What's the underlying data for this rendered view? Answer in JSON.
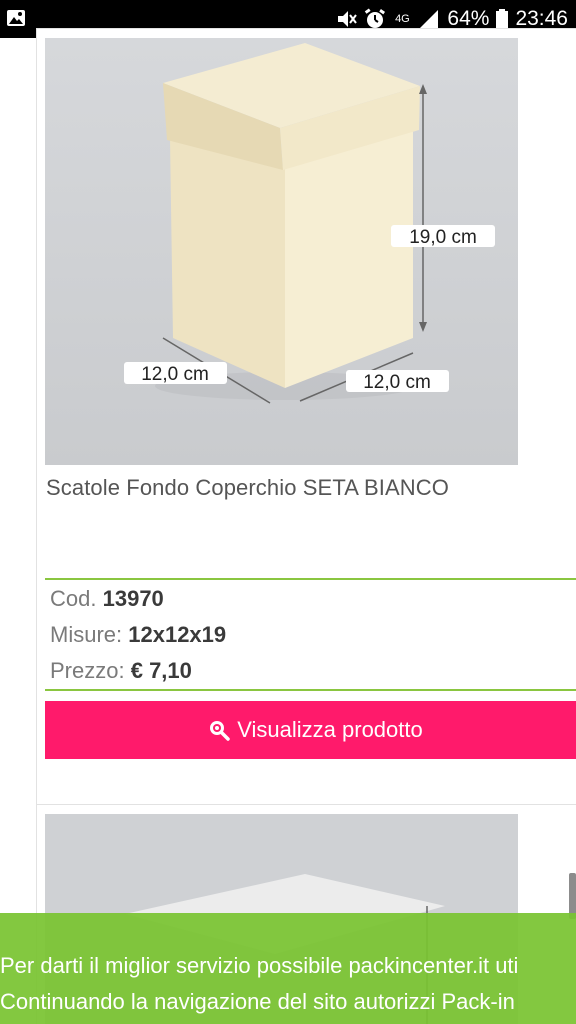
{
  "status_bar": {
    "network": "4G",
    "battery": "64%",
    "time": "23:46"
  },
  "product": {
    "image_labels": {
      "height": "19,0 cm",
      "depth": "12,0 cm",
      "width": "12,0 cm"
    },
    "title": "Scatole Fondo Coperchio SETA BIANCO",
    "code_label": "Cod.",
    "code_value": "13970",
    "size_label": "Misure:",
    "size_value": "12x12x19",
    "price_label": "Prezzo:",
    "price_value": "€ 7,10",
    "view_button": "Visualizza prodotto"
  },
  "cookie_banner": {
    "line1": "Per darti il miglior servizio possibile packincenter.it uti",
    "line2": "Continuando la navigazione del sito autorizzi Pack-in"
  },
  "colors": {
    "accent_pink": "#ff1a6b",
    "accent_green": "#8ac640",
    "banner_green": "#7ac432"
  }
}
